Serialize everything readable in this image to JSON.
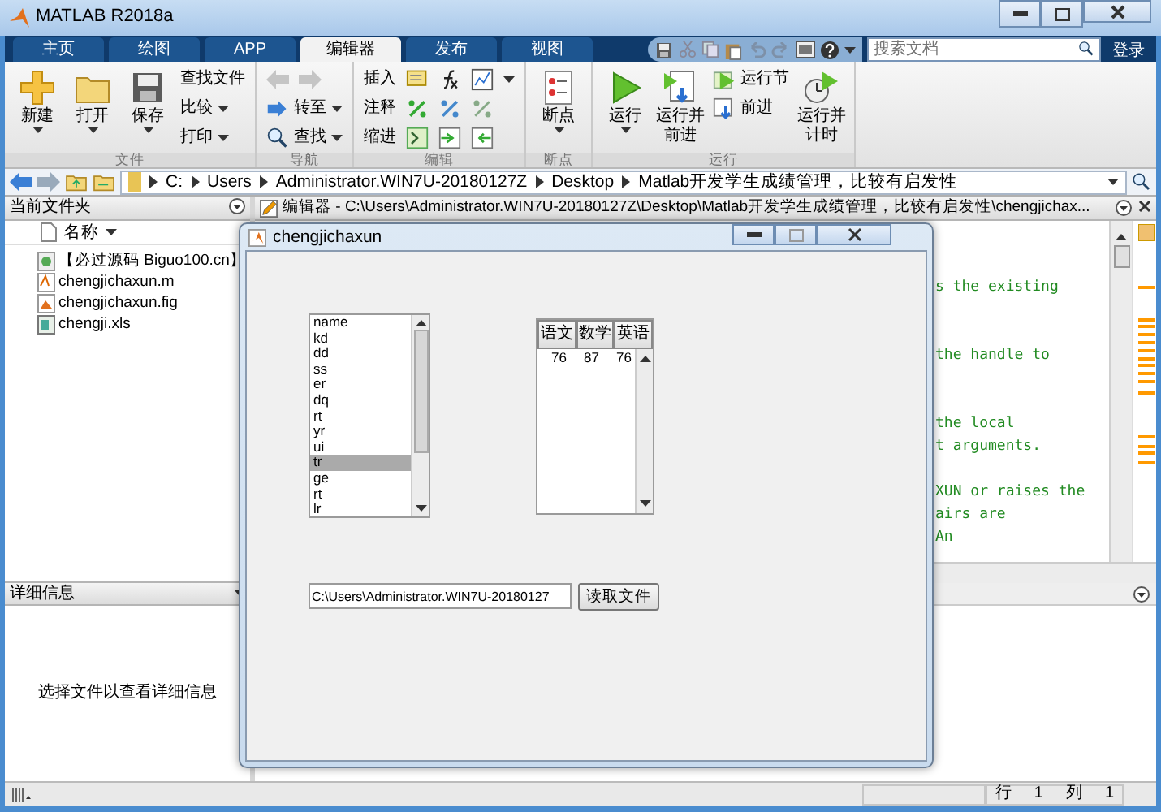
{
  "window": {
    "title": "MATLAB R2018a"
  },
  "tabs": [
    {
      "label": "主页",
      "selected": false
    },
    {
      "label": "绘图",
      "selected": false
    },
    {
      "label": "APP",
      "selected": false
    },
    {
      "label": "编辑器",
      "selected": true
    },
    {
      "label": "发布",
      "selected": false
    },
    {
      "label": "视图",
      "selected": false
    }
  ],
  "search": {
    "placeholder": "搜索文档"
  },
  "login": "登录",
  "ribbon": [
    {
      "label": "文件",
      "columns": [
        {
          "kind": "large",
          "label": "新建",
          "dropdown": true
        },
        {
          "kind": "large",
          "label": "打开",
          "dropdown": true
        },
        {
          "kind": "large",
          "label": "保存",
          "dropdown": true
        },
        {
          "kind": "stack",
          "items": [
            {
              "kind": "button",
              "label": "查找文件",
              "dropdown": false
            },
            {
              "kind": "button",
              "label": "比较",
              "dropdown": true
            },
            {
              "kind": "button",
              "label": "打印",
              "dropdown": true
            }
          ]
        }
      ]
    },
    {
      "label": "导航",
      "columns": [
        {
          "kind": "stack",
          "items": [
            {
              "kind": "arrows",
              "disabled": true
            },
            {
              "kind": "button",
              "label": "转至",
              "dropdown": true
            },
            {
              "kind": "button",
              "label": "查找",
              "dropdown": true
            }
          ]
        }
      ]
    },
    {
      "label": "编辑",
      "columns": [
        {
          "kind": "stack",
          "items": [
            {
              "kind": "tools",
              "label": "插入",
              "dropdown": true
            },
            {
              "kind": "tools",
              "label": "注释",
              "dropdown": false
            },
            {
              "kind": "tools",
              "label": "缩进",
              "dropdown": false
            }
          ]
        }
      ]
    },
    {
      "label": "断点",
      "columns": [
        {
          "kind": "large",
          "label": "断点",
          "dropdown": true
        }
      ]
    },
    {
      "label": "运行",
      "columns": [
        {
          "kind": "large",
          "label": "运行",
          "dropdown": true
        },
        {
          "kind": "large",
          "label": "运行并前进",
          "dropdown": false
        },
        {
          "kind": "stack",
          "items": [
            {
              "kind": "button",
              "label": "运行节",
              "dropdown": false
            },
            {
              "kind": "button",
              "label": "前进",
              "dropdown": false
            }
          ]
        },
        {
          "kind": "large",
          "label": "运行并计时",
          "dropdown": false
        }
      ]
    }
  ],
  "address_bar": {
    "path": [
      "C:",
      "Users",
      "Administrator.WIN7U-20180127Z",
      "Desktop",
      "Matlab开发学生成绩管理，比较有启发性"
    ]
  },
  "current_folder": {
    "title": "当前文件夹",
    "column": "名称",
    "files": [
      {
        "name": "【必过源码 Biguo100.cn】",
        "kind": "web"
      },
      {
        "name": "chengjichaxun.m",
        "kind": "m"
      },
      {
        "name": "chengjichaxun.fig",
        "kind": "fig"
      },
      {
        "name": "chengji.xls",
        "kind": "xls"
      }
    ]
  },
  "details": {
    "title": "详细信息",
    "message": "选择文件以查看详细信息"
  },
  "editor": {
    "title": "编辑器 - C:\\Users\\Administrator.WIN7U-20180127Z\\Desktop\\Matlab开发学生成绩管理，比较有启发性\\chengjichax...",
    "lines": [
      {
        "kind": "blank"
      },
      {
        "kind": "blank"
      },
      {
        "kind": "comment",
        "text": "s the existing"
      },
      {
        "kind": "blank"
      },
      {
        "kind": "blank"
      },
      {
        "kind": "comment",
        "text": "the handle to"
      },
      {
        "kind": "blank"
      },
      {
        "kind": "blank"
      },
      {
        "kind": "comment",
        "text": "the local"
      },
      {
        "kind": "comment",
        "text": "t arguments."
      },
      {
        "kind": "blank"
      },
      {
        "kind": "comment",
        "text": "XUN or raises the"
      },
      {
        "kind": "comment",
        "text": "airs are"
      },
      {
        "kind": "comment",
        "text": "An"
      }
    ]
  },
  "status_bar": {
    "row_label": "行",
    "row": "1",
    "col_label": "列",
    "col": "1"
  },
  "figure": {
    "title": "chengjichaxun",
    "listbox": {
      "items": [
        {
          "label": "name",
          "selected": false
        },
        {
          "label": "kd",
          "selected": false
        },
        {
          "label": "dd",
          "selected": false
        },
        {
          "label": "ss",
          "selected": false
        },
        {
          "label": "er",
          "selected": false
        },
        {
          "label": "dq",
          "selected": false
        },
        {
          "label": "rt",
          "selected": false
        },
        {
          "label": "yr",
          "selected": false
        },
        {
          "label": "ui",
          "selected": false
        },
        {
          "label": "tr",
          "selected": true
        },
        {
          "label": "ge",
          "selected": false
        },
        {
          "label": "rt",
          "selected": false
        },
        {
          "label": "lr",
          "selected": false
        }
      ]
    },
    "table": {
      "columns": [
        "语文",
        "数学",
        "英语"
      ],
      "rows": [
        [
          "76",
          "87",
          "76"
        ]
      ]
    },
    "path_field": {
      "value": "C:\\Users\\Administrator.WIN7U-20180127"
    },
    "button": "读取文件"
  }
}
